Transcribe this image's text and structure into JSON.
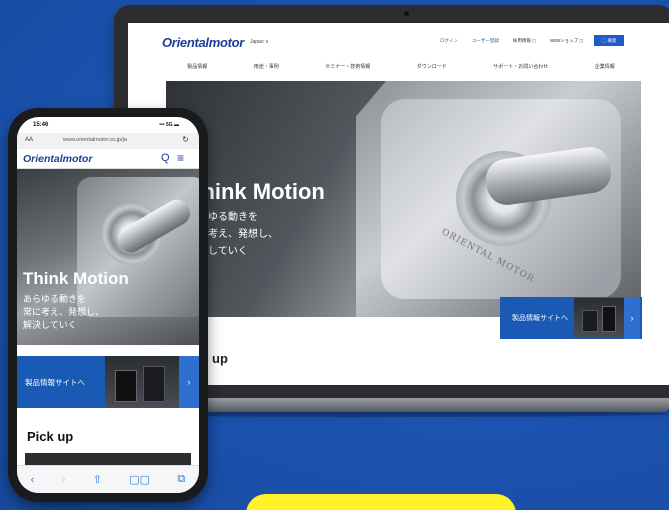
{
  "laptop": {
    "logo": "Orientalmotor",
    "language": "Japan ∨",
    "utility_links": [
      "ログイン",
      "ユーザー登録",
      "採用情報 ◻",
      "WEBショップ ◻"
    ],
    "search_button": "◯ 検索",
    "nav": [
      "製品情報",
      "用途・事例",
      "セミナー・技術情報",
      "ダウンロード",
      "サポート・お問い合わせ",
      "企業情報"
    ],
    "hero_title": "Think Motion",
    "hero_subtitle": "あらゆる動きを\n常に考え、発想し、\n解決していく",
    "motor_engraving": "ORIENTAL MOTOR",
    "product_button": "製品情報サイトへ",
    "product_chevron": "›",
    "pickup": "up"
  },
  "phone": {
    "time": "15:46",
    "signal": "••• 5G ▬",
    "aa": "AA",
    "url": "www.orientalmotor.co.jp/ja",
    "reload_icon": "↻",
    "logo": "Orientalmotor",
    "search_icon": "Q",
    "menu_icon": "≡",
    "hero_title": "Think Motion",
    "hero_subtitle": "あらゆる動きを\n常に考え、発想し、\n解決していく",
    "product_button": "製品情報サイトへ",
    "product_chevron": "›",
    "pickup": "Pick up",
    "toolbar": [
      "‹",
      "›",
      "⇧",
      "▢▢",
      "⧉"
    ]
  },
  "colors": {
    "background": "#1d55b4",
    "brand_blue": "#1c3f95",
    "button_blue": "#1a5ab5",
    "cta_yellow": "#fff22a"
  }
}
